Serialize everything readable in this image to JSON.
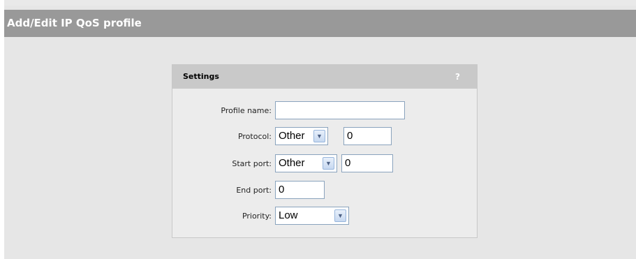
{
  "page": {
    "title": "Add/Edit IP QoS profile"
  },
  "settings": {
    "title": "Settings",
    "help_glyph": "?",
    "profile_name": {
      "label": "Profile name:",
      "value": ""
    },
    "protocol": {
      "label": "Protocol:",
      "selected": "Other",
      "number": "0"
    },
    "start_port": {
      "label": "Start port:",
      "selected": "Other",
      "number": "0"
    },
    "end_port": {
      "label": "End port:",
      "value": "0"
    },
    "priority": {
      "label": "Priority:",
      "selected": "Low"
    }
  },
  "icons": {
    "dropdown": "chevron-down-icon",
    "help": "help-icon"
  }
}
